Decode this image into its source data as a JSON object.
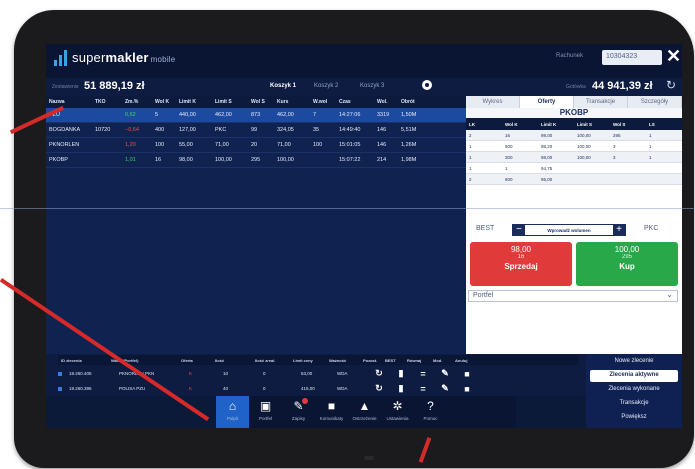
{
  "app": {
    "brand_prefix": "super",
    "brand_bold": "makler",
    "brand_suffix": "mobile"
  },
  "header": {
    "account_label": "Rachunek",
    "account_value": "10304323",
    "close_glyph": "✕"
  },
  "summary": {
    "left_label": "Zestawienie",
    "left_value": "51 889,19 zł",
    "baskets": [
      "Koszyk 1",
      "Koszyk 2",
      "Koszyk 3"
    ],
    "right_label": "Gotówka",
    "right_value": "44 941,39 zł",
    "refresh_glyph": "↻"
  },
  "grid": {
    "headers": [
      "Nazwa",
      "TKO",
      "Zm.%",
      "Wol K",
      "Limit K",
      "Limit S",
      "Wol S",
      "Kurs",
      "W.wol",
      "Czas",
      "Wol.",
      "Obrót"
    ],
    "rows": [
      {
        "c": [
          "PZU",
          "",
          "0,62",
          "5",
          "440,00",
          "462,00",
          "873",
          "462,00",
          "7",
          "14:27:06",
          "3319",
          "1,50M"
        ],
        "sel": true,
        "chg": "green"
      },
      {
        "c": [
          "BOGDANKA",
          "10720",
          "−0,64",
          "400",
          "127,00",
          "PKC",
          "99",
          "324,05",
          "35",
          "14:49:40",
          "146",
          "5,51M"
        ],
        "sel": false,
        "chg": "red"
      },
      {
        "c": [
          "PKNORLEN",
          "",
          "1,20",
          "100",
          "55,00",
          "71,00",
          "20",
          "71,00",
          "100",
          "15:01:05",
          "146",
          "1,26M"
        ],
        "sel": false,
        "chg": "red"
      },
      {
        "c": [
          "PKOBP",
          "",
          "1,01",
          "16",
          "98,00",
          "100,00",
          "295",
          "100,00",
          "",
          "15:07:22",
          "214",
          "1,98M"
        ],
        "sel": false,
        "chg": "green"
      }
    ]
  },
  "panel": {
    "tabs": [
      "Wykres",
      "Oferty",
      "Transakcje",
      "Szczegóły"
    ],
    "title": "PKOBP",
    "book_headers": [
      "LK",
      "Wol K",
      "Limit K",
      "Limit S",
      "Wol S",
      "LS"
    ],
    "book": [
      [
        "2",
        "16",
        "98,00",
        "100,00",
        "295",
        "1"
      ],
      [
        "1",
        "500",
        "98,20",
        "100,00",
        "3",
        "1"
      ],
      [
        "1",
        "300",
        "98,00",
        "100,00",
        "3",
        "1"
      ],
      [
        "1",
        "1",
        "94,75",
        "",
        "",
        ""
      ],
      [
        "2",
        "600",
        "95,00",
        "",
        "",
        ""
      ]
    ],
    "best": "BEST",
    "volume_placeholder": "Wprowadź wolumen",
    "pkc": "PKC",
    "sell": {
      "price": "98,00",
      "qty": "16",
      "label": "Sprzedaj"
    },
    "buy": {
      "price": "100,00",
      "qty": "295",
      "label": "Kup"
    },
    "portfolio": "Portfel"
  },
  "orders": {
    "headers": [
      "ID zlecenia",
      "Walor (Portfel)",
      "Oferta",
      "Ilość",
      "Ilość zreal.",
      "Limit ceny",
      "Ważność",
      "Pozost.",
      "BEST",
      "Równaj",
      "Mod.",
      "Anuluj"
    ],
    "rows": [
      {
        "id": "19.260.405",
        "walor": "PKNORLEN PKN",
        "oferta": "K",
        "ilosc": "10",
        "zreal": "0",
        "limit": "63,00",
        "waznosc": "WDA"
      },
      {
        "id": "19.260.396",
        "walor": "POLISA PZU",
        "oferta": "K",
        "ilosc": "40",
        "zreal": "0",
        "limit": "415,00",
        "waznosc": "WDA"
      }
    ],
    "side": [
      "Nowe zlecenie",
      "Zlecenia aktywne",
      "Zlecenia wykonane",
      "Transakcje",
      "Powiększ"
    ]
  },
  "nav": [
    {
      "label": "Pulpit",
      "icon": "home-icon",
      "glyph": "⌂"
    },
    {
      "label": "Portfel",
      "icon": "wallet-icon",
      "glyph": "▣"
    },
    {
      "label": "Zapisy",
      "icon": "edit-icon",
      "glyph": "✎"
    },
    {
      "label": "Komunikaty",
      "icon": "chat-icon",
      "glyph": "■"
    },
    {
      "label": "Ostrzeżenie",
      "icon": "warning-icon",
      "glyph": "▲"
    },
    {
      "label": "Ustawienia",
      "icon": "gear-icon",
      "glyph": "✲"
    },
    {
      "label": "Pomoc",
      "icon": "help-icon",
      "glyph": "?"
    }
  ],
  "colors": {
    "accent": "#1f62c8",
    "sell": "#e03a3a",
    "buy": "#29a84a",
    "callout": "#d62a2a"
  }
}
